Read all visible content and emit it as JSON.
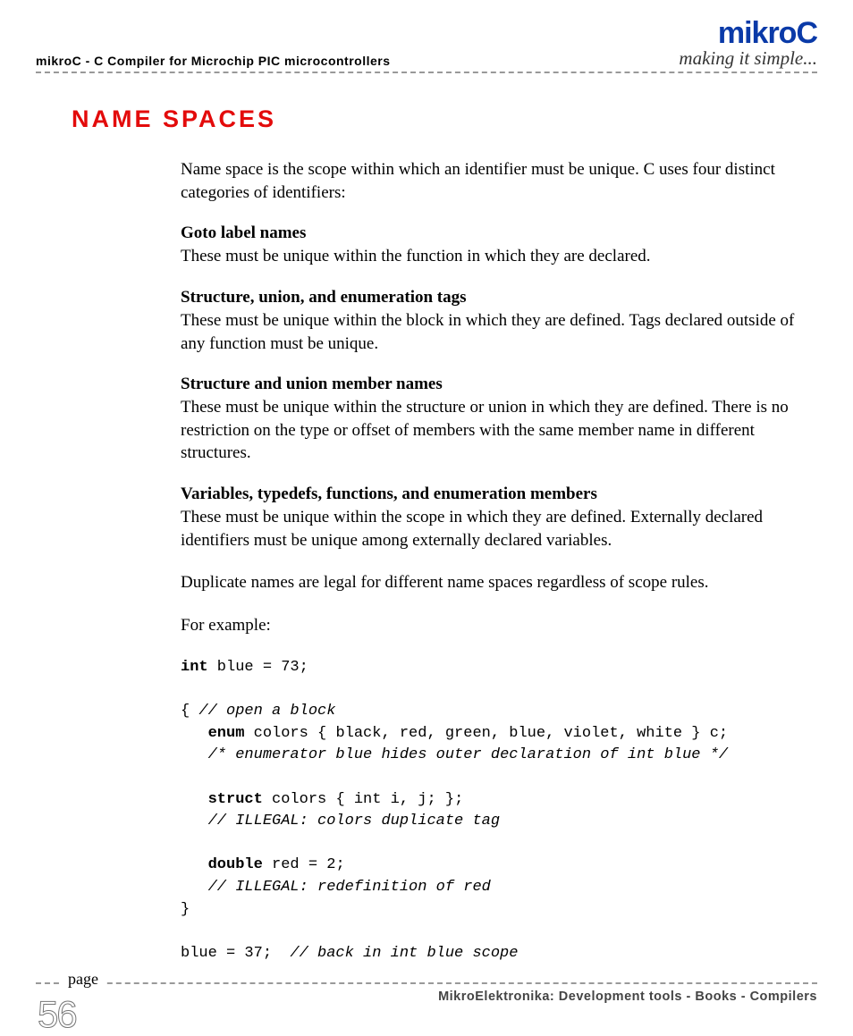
{
  "brand": {
    "name": "mikroC",
    "tagline": "making it simple..."
  },
  "header_subtitle": "mikroC - C Compiler for Microchip PIC microcontrollers",
  "section_title": "NAME SPACES",
  "intro": "Name space is the scope within which an identifier must be unique. C uses four distinct categories of identifiers:",
  "groups": [
    {
      "heading": "Goto label names",
      "body": "These must be unique within the function in which they are declared."
    },
    {
      "heading": "Structure, union, and enumeration tags",
      "body": "These must be unique within the block in which they are defined. Tags declared outside of any function must be unique."
    },
    {
      "heading": "Structure and union member names",
      "body": "These must be unique within the structure or union in which they are defined. There is no restriction on the type or offset of members with the same member name in different structures."
    },
    {
      "heading": "Variables, typedefs, functions, and enumeration members",
      "body": "These must be unique within the scope in which they are defined. Externally declared identifiers must be unique among externally declared variables."
    }
  ],
  "closing1": "Duplicate names are legal for different name spaces regardless of scope rules.",
  "closing2": "For example:",
  "code": {
    "l01a": "int",
    "l01b": " blue = 73;",
    "l02": "",
    "l03a": "{ ",
    "l03b": "// open a block",
    "l04a": "   enum",
    "l04b": " colors { black, red, green, blue, violet, white } c;",
    "l05": "   /* enumerator blue hides outer declaration of int blue */",
    "l06": "",
    "l07a": "   struct",
    "l07b": " colors { int i, j; };",
    "l08": "   // ILLEGAL: colors duplicate tag",
    "l09": "",
    "l10a": "   double",
    "l10b": " red = 2;",
    "l11": "   // ILLEGAL: redefinition of red",
    "l12": "}",
    "l13": "",
    "l14a": "blue = 37;  ",
    "l14b": "// back in int blue scope"
  },
  "footer": {
    "page_label": "page",
    "page_number": "56",
    "text": "MikroElektronika: Development tools - Books - Compilers"
  }
}
